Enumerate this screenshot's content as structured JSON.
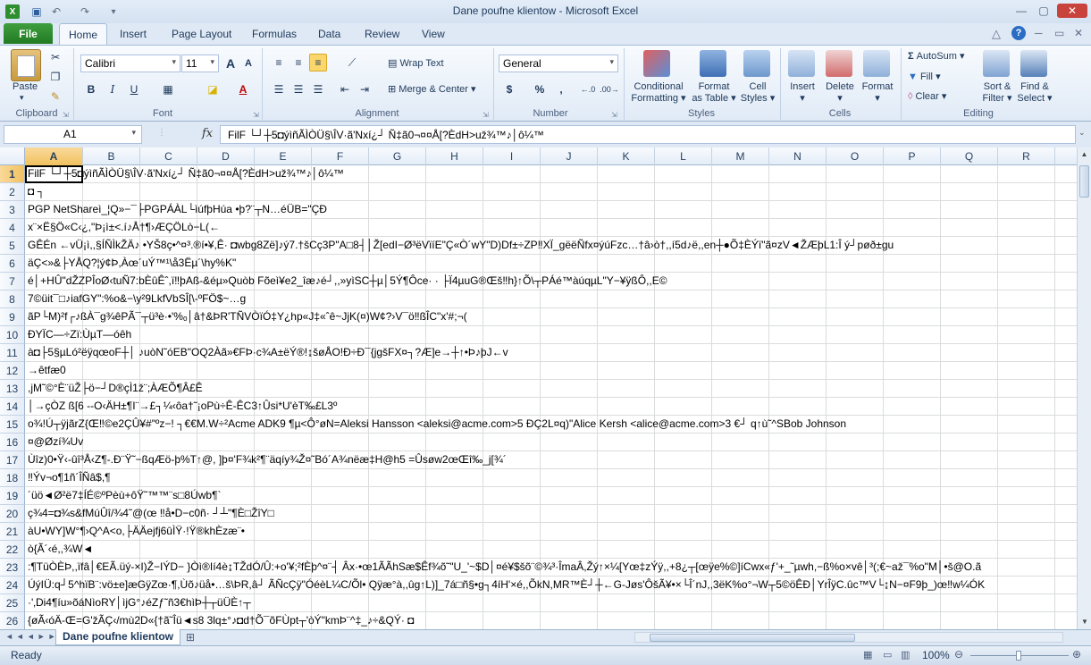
{
  "window": {
    "title": "Dane poufne klientow - Microsoft Excel"
  },
  "tabs": {
    "file": "File",
    "items": [
      "Home",
      "Insert",
      "Page Layout",
      "Formulas",
      "Data",
      "Review",
      "View"
    ]
  },
  "ribbon": {
    "clipboard": {
      "paste": "Paste",
      "label": "Clipboard"
    },
    "font": {
      "name": "Calibri",
      "size": "11",
      "bold": "B",
      "italic": "I",
      "underline": "U",
      "grow": "A",
      "shrink": "A",
      "label": "Font"
    },
    "alignment": {
      "wrap": "Wrap Text",
      "merge": "Merge & Center",
      "label": "Alignment"
    },
    "number": {
      "format": "General",
      "currency": "$",
      "percent": "%",
      "comma": ",",
      "label": "Number"
    },
    "styles": {
      "conditional_1": "Conditional",
      "conditional_2": "Formatting",
      "format_table_1": "Format",
      "format_table_2": "as Table",
      "cell_styles_1": "Cell",
      "cell_styles_2": "Styles",
      "label": "Styles"
    },
    "cells": {
      "insert": "Insert",
      "delete": "Delete",
      "format": "Format",
      "label": "Cells"
    },
    "editing": {
      "autosum": "AutoSum",
      "fill": "Fill",
      "clear": "Clear",
      "sort_1": "Sort &",
      "sort_2": "Filter",
      "find_1": "Find &",
      "find_2": "Select",
      "label": "Editing"
    }
  },
  "formula_bar": {
    "name_box": "A1",
    "fx": "fx",
    "content": "FilF   └┘┼5◘ýìñÃÌÒÜ§\\ÎV·ã'Nxí¿┘ Ñ‡ã0¬¤¤Å[?ÈdH>už¾™♪│ô¼™"
  },
  "columns": [
    "A",
    "B",
    "C",
    "D",
    "E",
    "F",
    "G",
    "H",
    "I",
    "J",
    "K",
    "L",
    "M",
    "N",
    "O",
    "P",
    "Q",
    "R"
  ],
  "rows": [
    {
      "n": "1",
      "t": "FilF   └┘┼5◘ýìñÃÌÒÜ§\\ÎV·ã'Nxí¿┘ Ñ‡ã0¬¤¤Å[?ÈdH>už¾™♪│ô¼™"
    },
    {
      "n": "2",
      "t": "◘    ┐"
    },
    {
      "n": "3",
      "t": "PGP NetShareì_¦Q»−¯├PGPÁÀL└ìúfþHúa    •þ?¨┬N…éÜB=\"ÇÐ"
    },
    {
      "n": "4",
      "t": "x¨×Ë§Ö«C‹¿,\"Þ¡ì±<.í♪Å†¶›ÆÇÖLò−L(←"
    },
    {
      "n": "5",
      "t": "GÊÉn ←vÜ¡ì,,§ÍÑÌkŽÄ♪ •YŠ8ç•^¤³.®í•¥,Ê· ◘wbg8Zë]♪ý7.†šCç3P\"A□8┤│Ž[edI−Ø³ëVïíE\"Ç«Ò´wY\"D)Df±÷ZP‼XÏ_gëëÑfx¤ýúFzc…†â›ò†,,í5d♪ë,,en┼●Õ‡ÈÝï\"ã¤zV◄ŽÆþL1:Î ý┘pøð±gu"
    },
    {
      "n": "6",
      "t": "äÇ<»&├YÅQ?¦ý¢Þ,Àœ´uÝ™¹\\å3Ëµ´\\hy%K\""
    },
    {
      "n": "7",
      "t": "é│+HÛ\"dŽZPÎoØ‹tuÑ7:bÈûÊˆ,ï‼þAß-&éµ»Quòb Fõeì¥e2_îæ♪é┘,,»yìSC┼µ│5Ý¶Ôce· · ├Ï4µuG®Œš‼h}↑Õ\\┬PÁé™àúqµL\"Y−¥ÿßÔ,,E©"
    },
    {
      "n": "8",
      "t": "7©üit¯□♪iafGY\":%o&−\\y²9LkfVbSÎ[\\-ºFÖ$~…g"
    },
    {
      "n": "9",
      "t": "ãP└M)²f┌♪ßÀ¯g¾êPÃ¯┬ü³è·•'%ₒ│â†&ÞR'TÑVÒïÓ‡Y¿hp«J‡«ˆê~JjK(¤)W¢?›V¯ö‼ßÎC\"x'#;¬("
    },
    {
      "n": "10",
      "t": "ÐYÏC—÷Zï:ÙµT—óêh"
    },
    {
      "n": "11",
      "t": "à◘├5§µLó²ëÿqœoF┼│ ♪uòN˜óEB\"OQ2Àã»€FÞ·c¾A±ëÝ®!↨šøÅO!Ð÷Ð¯{jgšFX¤┐?Æ]e→┼↑•Þ♪þJ←v"
    },
    {
      "n": "12",
      "t": "→êtfæ0"
    },
    {
      "n": "13",
      "t": ",jM˜©°È¨üŽ├ö−┘D®çÌ1ž¨;ÀÆÕ¶Â£Ê"
    },
    {
      "n": "14",
      "t": "│→çÒZ    ß[6 --O‹ÄH±¶I¨→£┐¼‹ôa†˜¡oPù÷Ê-ÊC3↑Ûsi*U'èT‰£L3º"
    },
    {
      "n": "15",
      "t": "o¾!Ú┬ÿjãrZ{Œ‼©e2ÇÛ¥#\"ºz−!         ┐€€M.W÷²Acme ADK9            ¶µ<Ô°øN=Aleksi Hansson <aleksi@acme.com>5           ÐÇ2L¤q)\"Alice Kersh <alice@acme.com>3               €┘ q↑ù˜^SBob Johnson"
    },
    {
      "n": "16",
      "t": "¤@Øzí¾Uv"
    },
    {
      "n": "17",
      "t": "Ùîz)0•Ÿ‹-ûî³Å‹Z¶-.Ð¨Ÿ˜−ßqÆö-þ%T↑@,     ]þ¤'F¾k²¶¨äqíy¾Ž¤˜Bó´A¾nëæ‡H@h5 =Ûsøw2œŒî‰_j[¾´"
    },
    {
      "n": "18",
      "t": "‼Ýv¬o¶1ñ´ÎÑâ$,¶"
    },
    {
      "n": "19",
      "t": "´üö◄Ø²ë7‡ÍÉ©ºPèù+ôŸ˜™™¨s□8Úwb¶`"
    },
    {
      "n": "20",
      "t": "ç¾4=◘¾s&fMúÛî/¾4˜@(œ ‼å•D−c0ñ· ┘┴\"¶È□ŽîY□"
    },
    {
      "n": "21",
      "t": "àU•WY]W°¶›Q^A<o,├ÄÄejfj6ûÌŸ·!Ÿ®khÈzæ¨•"
    },
    {
      "n": "22",
      "t": "ò{Ã´‹é,,¾W◄"
    },
    {
      "n": "23",
      "t": ":¶TüÒÈÞ,,ïfâ│€EÃ.üý-×I)Ž−IÝD−    }Òì®Ií4è↨TŽdÓ/Û:+o'¥;²fÈþ^¤¨┤ Âx·•œ1ÃÃhSæ$Êf¾õ˜\"U_'~$D│¤é¥$šõ¨©¾³·ÎmaÂ,Žý↑×¼[Yœ‡zÝÿ,,+8¿┬[œÿe%©]íCwx«ƒ'+_˜µwh,−ß%o×vê│³(;€~až¯%o\"M│•š@O.ã"
    },
    {
      "n": "24",
      "t": "ÚýIÜ:q┘5^hïB¨:vö±e]æGÿZœ·¶,Ùõ♪üå•…š\\ÞR,â┘ ÃÑcÇÿ\"ÓéèL¼C/Õl• Qÿæ°à,,ûg↑L)]_7á□ñ§•g┐4íH'×é,,ÕkN,MR™È┘┼←G-Jøs'ÔšÃ¥•×└Î´nJ,,3ëK%o°¬W┬5©öÊÐ│YrÎÿC.ûc™V└↨N−¤F9þ_)œ‼w¼ÓK"
    },
    {
      "n": "25",
      "t": "·'‚Di4¶íu»õáNìoRY│ìjG°♪éZƒ˜ñ3€hìÞ┼┬üÜÈ↑┬"
    },
    {
      "n": "26",
      "t": "{øÃ‹óÄ-Œ=G'žÃÇ‹/mù2D«{†ã˜Îü◄s8 3lq±°♪◘d†Õ¯õFÙpt┬'òÝ\"kmÞ¨^‡_♪÷&QÝ· ◘"
    }
  ],
  "sheet_tab": "Dane poufne klientow",
  "status": {
    "ready": "Ready",
    "zoom": "100%"
  },
  "colors": {
    "file_tab": "#2f8f2f",
    "accent": "#1e395b"
  }
}
